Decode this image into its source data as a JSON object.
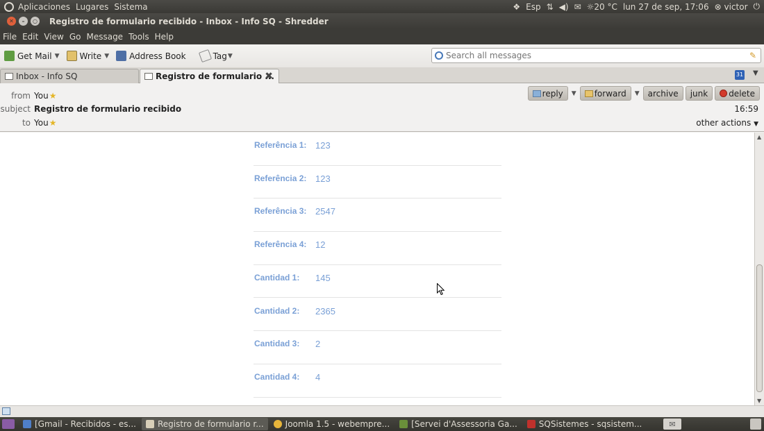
{
  "top_panel": {
    "menus": [
      "Aplicaciones",
      "Lugares",
      "Sistema"
    ],
    "keyboard": "Esp",
    "weather": "20 °C",
    "datetime": "lun 27 de sep, 17:06",
    "user": "victor"
  },
  "window": {
    "title": "Registro de formulario recibido - Inbox - Info SQ - Shredder"
  },
  "menubar": [
    "File",
    "Edit",
    "View",
    "Go",
    "Message",
    "Tools",
    "Help"
  ],
  "toolbar": {
    "get_mail": "Get Mail",
    "write": "Write",
    "address_book": "Address Book",
    "tag": "Tag",
    "search_placeholder": "Search all messages"
  },
  "tabs": [
    {
      "label": "Inbox - Info SQ"
    },
    {
      "label": "Registro de formulario ..."
    }
  ],
  "calendar_icon_text": "31",
  "header": {
    "from_label": "from",
    "from_value": "You",
    "subject_label": "subject",
    "subject_value": "Registro de formulario recibido",
    "to_label": "to",
    "to_value": "You",
    "time": "16:59",
    "other_actions": "other actions",
    "buttons": {
      "reply": "reply",
      "forward": "forward",
      "archive": "archive",
      "junk": "junk",
      "delete": "delete"
    }
  },
  "form_rows": [
    {
      "label": "Referência 1:",
      "value": "123"
    },
    {
      "label": "Referência 2:",
      "value": "123"
    },
    {
      "label": "Referência 3:",
      "value": "2547"
    },
    {
      "label": "Referência 4:",
      "value": "12"
    },
    {
      "label": "Cantidad 1:",
      "value": "145"
    },
    {
      "label": "Cantidad 2:",
      "value": "2365"
    },
    {
      "label": "Cantidad 3:",
      "value": "2"
    },
    {
      "label": "Cantidad 4:",
      "value": "4"
    }
  ],
  "taskbar": [
    {
      "label": "[Gmail - Recibidos - es...",
      "active": false
    },
    {
      "label": "Registro de formulario r...",
      "active": true
    },
    {
      "label": "Joomla 1.5 - webempre...",
      "active": false
    },
    {
      "label": "[Servei d'Assessoria Ga...",
      "active": false
    },
    {
      "label": "SQSistemes - sqsistem...",
      "active": false
    }
  ]
}
